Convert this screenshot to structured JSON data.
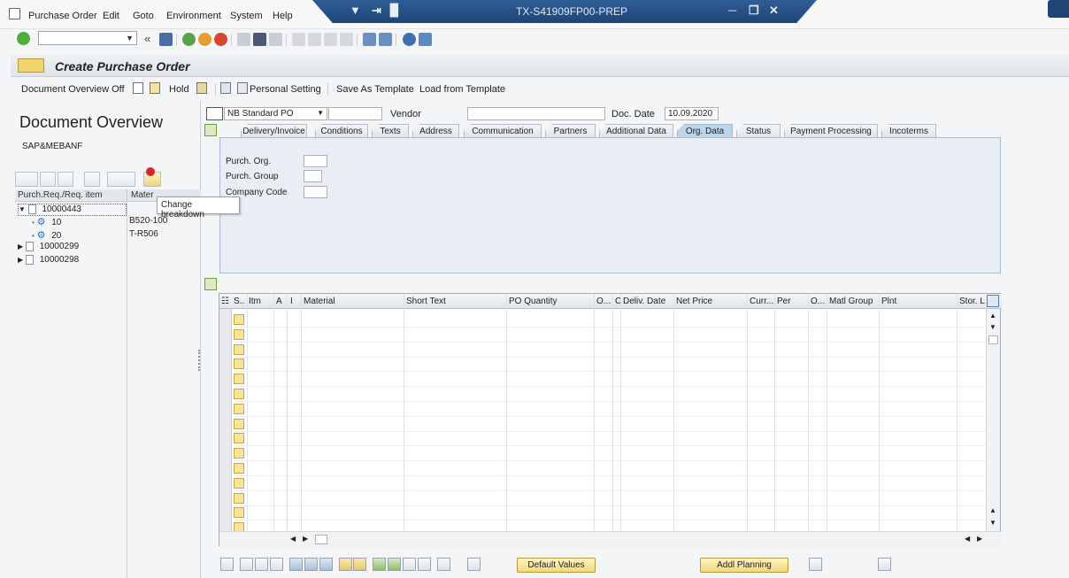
{
  "menu": {
    "items": [
      "Purchase Order",
      "Edit",
      "Goto",
      "Environment",
      "System",
      "Help"
    ],
    "window_title": "TX-S41909FP00-PREP"
  },
  "screen": {
    "title": "Create Purchase Order"
  },
  "appbar": {
    "document_overview_off": "Document Overview Off",
    "hold": "Hold",
    "personal_setting": "Personal Setting",
    "save_as_template": "Save As Template",
    "load_from_template": "Load from Template"
  },
  "left": {
    "heading": "Document Overview",
    "subheading": "SAP&MEBANF",
    "columns": [
      "Purch.Req./Req. item",
      "Mater"
    ],
    "tree": [
      {
        "id": "10000443",
        "expanded": true,
        "children": [
          {
            "item": "10",
            "material": "B520-100"
          },
          {
            "item": "20",
            "material": "T-R506"
          }
        ]
      },
      {
        "id": "10000299",
        "expanded": false
      },
      {
        "id": "10000298",
        "expanded": false
      }
    ],
    "tooltip": "Change breakdown"
  },
  "header": {
    "po_type": "NB Standard PO",
    "po_number": "",
    "vendor_label": "Vendor",
    "vendor_value": "",
    "doc_date_label": "Doc. Date",
    "doc_date": "10.09.2020"
  },
  "tabs": [
    {
      "label": "Delivery/Invoice",
      "active": false
    },
    {
      "label": "Conditions",
      "active": false
    },
    {
      "label": "Texts",
      "active": false
    },
    {
      "label": "Address",
      "active": false
    },
    {
      "label": "Communication",
      "active": false
    },
    {
      "label": "Partners",
      "active": false
    },
    {
      "label": "Additional Data",
      "active": false
    },
    {
      "label": "Org. Data",
      "active": true
    },
    {
      "label": "Status",
      "active": false
    },
    {
      "label": "Payment Processing",
      "active": false
    },
    {
      "label": "Incoterms",
      "active": false
    }
  ],
  "org_data": {
    "purch_org_label": "Purch. Org.",
    "purch_group_label": "Purch. Group",
    "company_code_label": "Company Code"
  },
  "items_grid": {
    "columns": [
      "S..",
      "Itm",
      "A",
      "I",
      "Material",
      "Short Text",
      "PO Quantity",
      "O...",
      "C",
      "Deliv. Date",
      "Net Price",
      "Curr...",
      "Per",
      "O...",
      "Matl Group",
      "Plnt",
      "Stor. L"
    ],
    "empty_rows": 15
  },
  "bottom": {
    "default_values": "Default Values",
    "addl_planning": "Addl Planning"
  },
  "colors": {
    "title_bar": "#1f4577",
    "active_tab": "#bdd5ea",
    "panel_bg": "#e9eef4",
    "button_yellow": "#f2d777",
    "row_marker": "#f8e39b"
  }
}
